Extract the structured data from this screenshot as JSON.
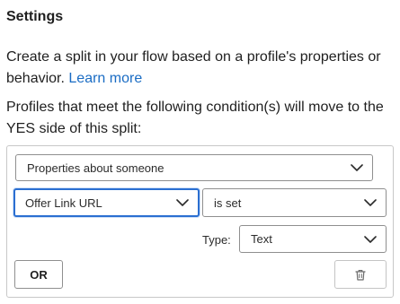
{
  "settings": {
    "heading": "Settings",
    "description_text": "Create a split in your flow based on a profile's properties or behavior.",
    "learn_more": "Learn more",
    "condition_text": "Profiles that meet the following condition(s) will move to the YES side of this split:"
  },
  "condition": {
    "category_select": {
      "value": "Properties about someone",
      "icon": "chevron-down-icon"
    },
    "property_select": {
      "value": "Offer Link URL",
      "icon": "chevron-down-icon",
      "focused": true
    },
    "operator_select": {
      "value": "is set",
      "icon": "chevron-down-icon"
    },
    "type_label": "Type:",
    "type_select": {
      "value": "Text",
      "icon": "chevron-down-icon"
    },
    "or_button": "OR",
    "delete_button": {
      "icon": "trash-icon"
    }
  },
  "colors": {
    "link": "#1a6cc4",
    "focus_border": "#2b6fd1",
    "border": "#8f8f8f",
    "text": "#1f1f1f"
  }
}
